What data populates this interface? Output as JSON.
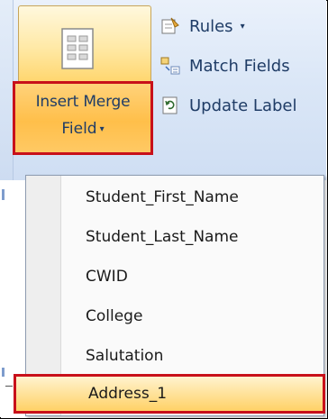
{
  "ribbon": {
    "insert_merge_field": {
      "line1": "Insert Merge",
      "line2": "Field",
      "caret": "▾"
    },
    "rules": {
      "label": "Rules",
      "caret": "▾"
    },
    "match_fields": {
      "label": "Match Fields"
    },
    "update_labels": {
      "label": "Update Label"
    }
  },
  "menu": {
    "items": [
      {
        "label": "Student_First_Name"
      },
      {
        "label": "Student_Last_Name"
      },
      {
        "label": "CWID"
      },
      {
        "label": "College"
      },
      {
        "label": "Salutation"
      },
      {
        "label": "Address_1"
      }
    ]
  },
  "colors": {
    "highlight_border": "#c8101a",
    "button_gradient_top": "#ffd27a",
    "text_blue": "#1f3c66"
  }
}
